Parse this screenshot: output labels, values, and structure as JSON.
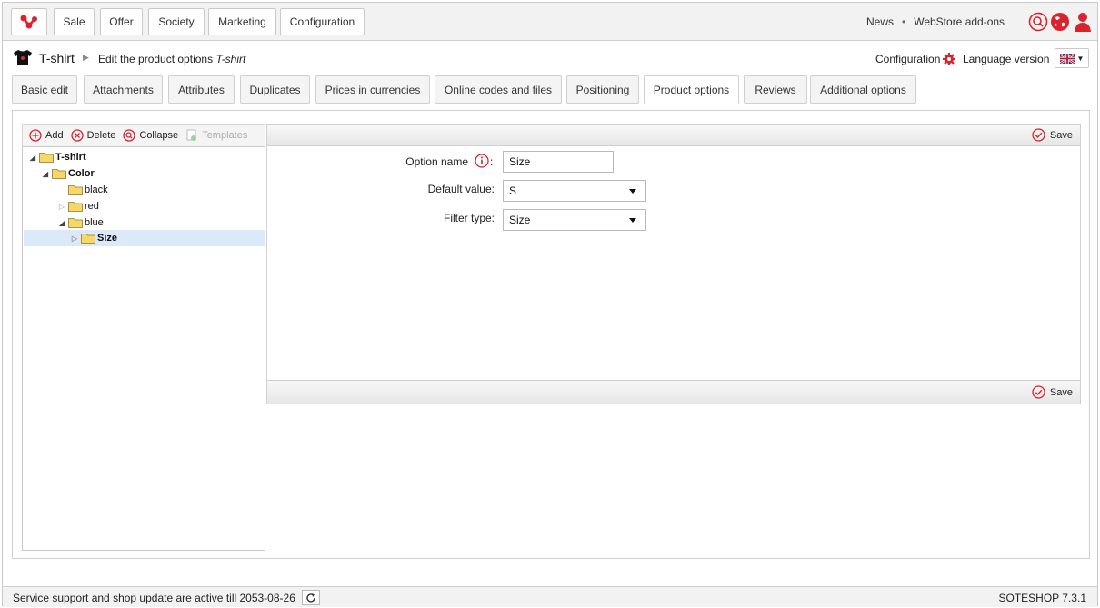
{
  "nav": {
    "items": [
      "Sale",
      "Offer",
      "Society",
      "Marketing",
      "Configuration"
    ]
  },
  "top_links": {
    "news": "News",
    "addons": "WebStore add-ons"
  },
  "breadcrumb": {
    "product": "T-shirt",
    "page": "Edit the product options",
    "page_product": "T-shirt"
  },
  "header_right": {
    "configuration": "Configuration",
    "language_version": "Language version"
  },
  "tabs": [
    "Basic edit",
    "Attachments",
    "Attributes",
    "Duplicates",
    "Prices in currencies",
    "Online codes and files",
    "Positioning",
    "Product options",
    "Reviews",
    "Additional options"
  ],
  "active_tab": "Product options",
  "tree_toolbar": {
    "add": "Add",
    "delete": "Delete",
    "collapse": "Collapse",
    "templates": "Templates"
  },
  "tree": {
    "root": "T-shirt",
    "color": "Color",
    "black": "black",
    "red": "red",
    "blue": "blue",
    "size": "Size"
  },
  "form": {
    "save": "Save",
    "option_name_label": "Option name",
    "option_name_value": "Size",
    "default_value_label": "Default value:",
    "default_value": "S",
    "filter_type_label": "Filter type:",
    "filter_type_value": "Size"
  },
  "status": {
    "text": "Service support and shop update are active till 2053-08-26",
    "version": "SOTESHOP 7.3.1"
  },
  "colors": {
    "accent": "#d9232d",
    "selection": "#dce9fa",
    "folder": "#f7d766"
  }
}
